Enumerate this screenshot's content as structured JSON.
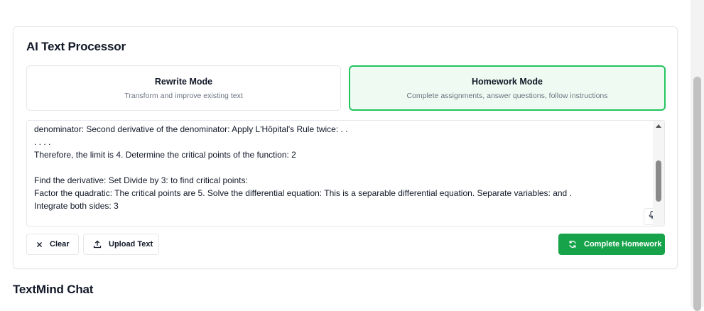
{
  "processor": {
    "title": "AI Text Processor",
    "modes": [
      {
        "title": "Rewrite Mode",
        "description": "Transform and improve existing text",
        "selected": false
      },
      {
        "title": "Homework Mode",
        "description": "Complete assignments, answer questions, follow instructions",
        "selected": true
      }
    ],
    "text_lines": [
      "denominator: Second derivative of the denominator: Apply L'Hôpital's Rule twice: . .",
      ". . . .",
      "Therefore, the limit is 4. Determine the critical points of the function: 2",
      "",
      "Find the derivative: Set Divide by 3: to find critical points:",
      "Factor the quadratic: The critical points are 5. Solve the differential equation: This is a separable differential equation. Separate variables: and .",
      "Integrate both sides: 3"
    ],
    "buttons": {
      "clear": "Clear",
      "upload": "Upload Text",
      "submit": "Complete Homework"
    },
    "icons": {
      "clear": "x-icon",
      "upload": "upload-icon",
      "submit": "refresh-icon",
      "mic": "microphone-icon"
    },
    "colors": {
      "accent": "#16a34a",
      "selected_border": "#22c55e",
      "selected_bg": "#effbf2"
    }
  },
  "chat": {
    "title": "TextMind Chat"
  }
}
